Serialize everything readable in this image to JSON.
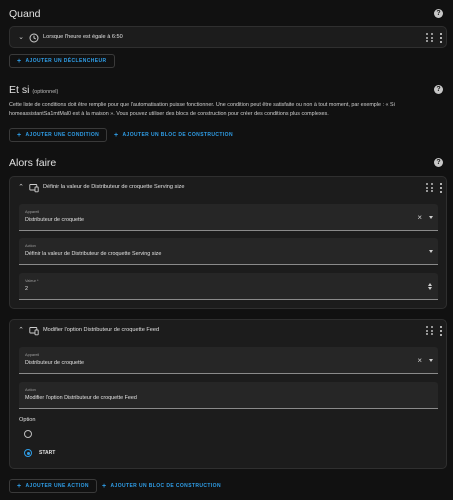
{
  "when": {
    "title": "Quand",
    "trigger_label": "Lorsque l'heure est égale à 6:50",
    "add_trigger": "AJOUTER UN DÉCLENCHEUR"
  },
  "if": {
    "title": "Et si",
    "optional": "(optionnel)",
    "description": "Cette liste de conditions doit être remplie pour que l'automatisation puisse fonctionner. Une condition peut être satisfaite ou non à tout moment, par exemple : « Si homeassistantSa1mtMal0 est à la maison ». Vous pouvez utiliser des blocs de construction pour créer des conditions plus complexes.",
    "add_condition": "AJOUTER UNE CONDITION",
    "add_block": "AJOUTER UN BLOC DE CONSTRUCTION"
  },
  "then": {
    "title": "Alors faire",
    "action1": {
      "title": "Définir la valeur de Distributeur de croquette Serving size",
      "device_label": "Appareil",
      "device_value": "Distributeur de croquette",
      "action_label": "Action",
      "action_value": "Définir la valeur de Distributeur de croquette Serving size",
      "value_label": "Valeur *",
      "value_value": "2"
    },
    "action2": {
      "title": "Modifier l'option Distributeur de croquette Feed",
      "device_label": "Appareil",
      "device_value": "Distributeur de croquette",
      "action_label": "Action",
      "action_value": "Modifier l'option Distributeur de croquette Feed",
      "option_label": "Option",
      "option_1": "",
      "option_2": "START",
      "selected_option": "START"
    },
    "add_action": "AJOUTER UNE ACTION",
    "add_block": "AJOUTER UN BLOC DE CONSTRUCTION"
  },
  "colors": {
    "accent": "#2f9ee8",
    "background": "#111111",
    "card": "#1c1c1c"
  },
  "icons": {
    "help": "help-circle-icon",
    "chevron": "chevron-down-icon",
    "clock": "clock-icon",
    "device": "device-icon",
    "drag": "drag-handle-icon",
    "menu": "more-vertical-icon",
    "plus": "plus-icon",
    "clear": "close-icon"
  }
}
